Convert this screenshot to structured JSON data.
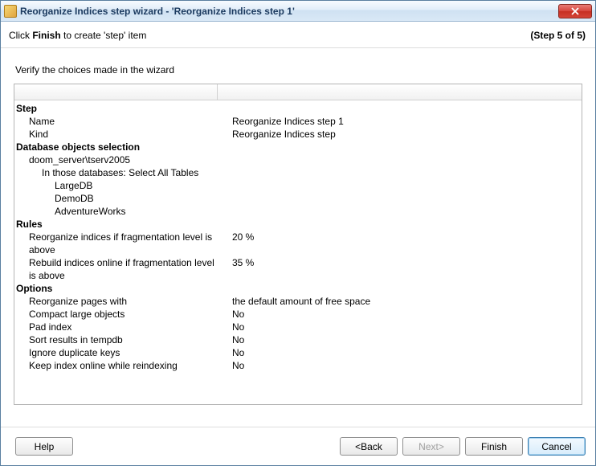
{
  "titlebar": {
    "title": "Reorganize Indices step wizard - 'Reorganize Indices step 1'"
  },
  "header": {
    "prefix": "Click ",
    "bold": "Finish",
    "suffix": " to create 'step' item",
    "step_label": "(Step 5 of 5)"
  },
  "verify_label": "Verify the choices made in the wizard",
  "sections": {
    "step": {
      "heading": "Step",
      "name_label": "Name",
      "name_value": "Reorganize Indices step 1",
      "kind_label": "Kind",
      "kind_value": "Reorganize Indices step"
    },
    "db": {
      "heading": "Database objects selection",
      "server": "doom_server\\tserv2005",
      "in_those": "In those databases: Select All Tables",
      "db1": "LargeDB",
      "db2": "DemoDB",
      "db3": "AdventureWorks"
    },
    "rules": {
      "heading": "Rules",
      "r1_label": "Reorganize indices if fragmentation level is above",
      "r1_value": "20 %",
      "r2_label": "Rebuild indices online if fragmentation level is above",
      "r2_value": "35 %"
    },
    "options": {
      "heading": "Options",
      "o1_label": "Reorganize pages with",
      "o1_value": "the default amount of free space",
      "o2_label": "Compact large objects",
      "o2_value": "No",
      "o3_label": "Pad index",
      "o3_value": "No",
      "o4_label": "Sort results in tempdb",
      "o4_value": "No",
      "o5_label": "Ignore duplicate keys",
      "o5_value": "No",
      "o6_label": "Keep index online while reindexing",
      "o6_value": "No"
    }
  },
  "buttons": {
    "help": "Help",
    "back": "<Back",
    "next": "Next>",
    "finish": "Finish",
    "cancel": "Cancel"
  }
}
